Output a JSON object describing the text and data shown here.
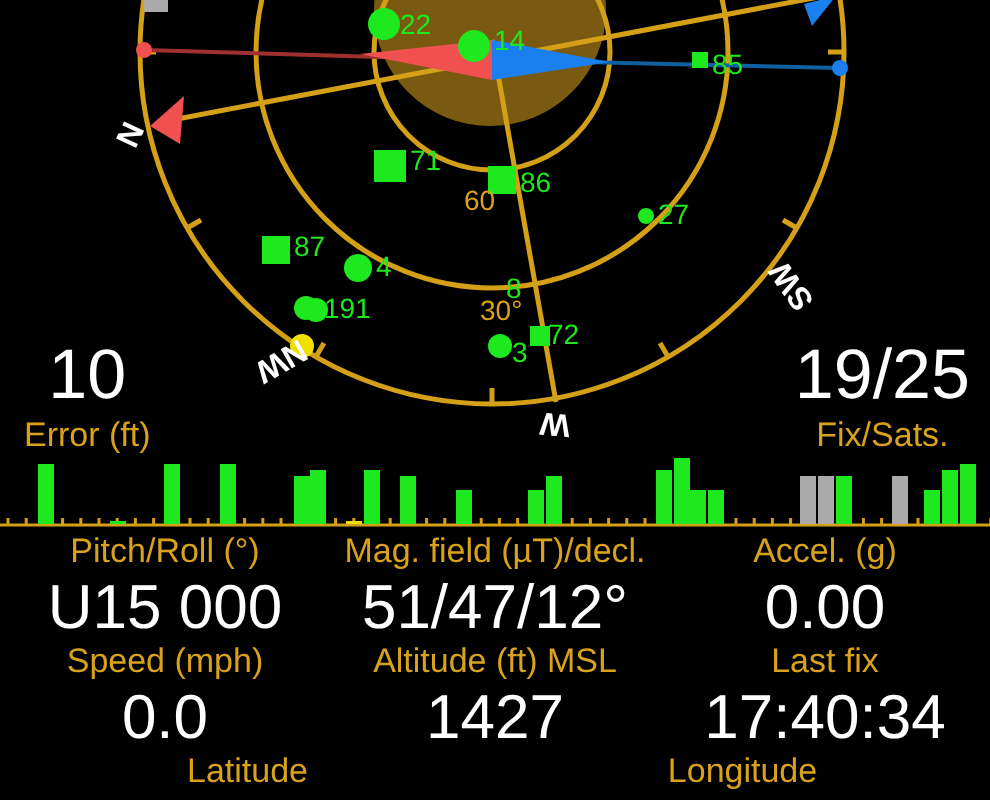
{
  "sky_plot": {
    "directions": [
      {
        "label": "N"
      },
      {
        "label": "NW"
      },
      {
        "label": "W"
      },
      {
        "label": "SW"
      }
    ],
    "ring_labels": [
      "60",
      "30°"
    ],
    "satellites": [
      {
        "label": "22",
        "kind": "circle",
        "color": "#1ee81e"
      },
      {
        "label": "14",
        "kind": "circle",
        "color": "#1ee81e"
      },
      {
        "label": "85",
        "kind": "square",
        "color": "#1ee81e"
      },
      {
        "label": "71",
        "kind": "square",
        "color": "#1ee81e"
      },
      {
        "label": "86",
        "kind": "square",
        "color": "#1ee81e"
      },
      {
        "label": "27",
        "kind": "circle",
        "color": "#1ee81e"
      },
      {
        "label": "87",
        "kind": "square",
        "color": "#1ee81e"
      },
      {
        "label": "4",
        "kind": "circle",
        "color": "#1ee81e"
      },
      {
        "label": "191",
        "kind": "circle",
        "color": "#1ee81e"
      },
      {
        "label": "8",
        "kind": "label",
        "color": "#1ee81e"
      },
      {
        "label": "3",
        "kind": "circle",
        "color": "#1ee81e"
      },
      {
        "label": "72",
        "kind": "square",
        "color": "#1ee81e"
      }
    ],
    "unlabeled_satellites": [
      {
        "kind": "square",
        "color": "#aaaaaa"
      },
      {
        "kind": "circle",
        "color": "#f0e000"
      },
      {
        "kind": "circle",
        "color": "#1ee81e"
      }
    ]
  },
  "error": {
    "value": "10",
    "label": "Error (ft)"
  },
  "fix": {
    "value": "19/25",
    "label": "Fix/Sats."
  },
  "bars": [
    {
      "color": "#1ee81e"
    },
    {
      "color": "#1ee81e"
    },
    {
      "color": "#1ee81e"
    },
    {
      "color": "#1ee81e"
    },
    {
      "color": "#1ee81e"
    },
    {
      "color": "#1ee81e"
    },
    {
      "color": "#f0e000"
    },
    {
      "color": "#1ee81e"
    },
    {
      "color": "#1ee81e"
    },
    {
      "color": "#1ee81e"
    },
    {
      "color": "#1ee81e"
    },
    {
      "color": "#1ee81e"
    },
    {
      "color": "#1ee81e"
    },
    {
      "color": "#1ee81e"
    },
    {
      "color": "#1ee81e"
    },
    {
      "color": "#1ee81e"
    },
    {
      "color": "#aaaaaa"
    },
    {
      "color": "#aaaaaa"
    },
    {
      "color": "#1ee81e"
    },
    {
      "color": "#aaaaaa"
    },
    {
      "color": "#1ee81e"
    },
    {
      "color": "#1ee81e"
    },
    {
      "color": "#1ee81e"
    }
  ],
  "readings": [
    {
      "label": "Pitch/Roll (°)",
      "value": "U15 000"
    },
    {
      "label": "Mag. field (µT)/decl.",
      "value": "51/47/12°"
    },
    {
      "label": "Accel. (g)",
      "value": "0.00"
    },
    {
      "label": "Speed (mph)",
      "value": "0.0"
    },
    {
      "label": "Altitude (ft) MSL",
      "value": "1427"
    },
    {
      "label": "Last fix",
      "value": "17:40:34"
    }
  ],
  "cut_labels": [
    "Latitude",
    "Longitude"
  ]
}
